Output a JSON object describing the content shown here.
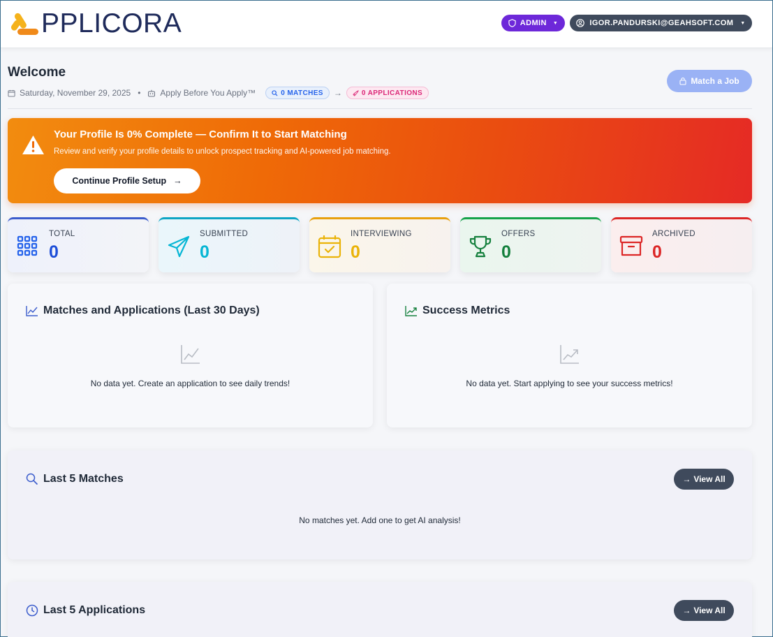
{
  "header": {
    "logo_text": "PPLICORA",
    "admin_label": "ADMIN",
    "user_label": "IGOR.PANDURSKI@GEAHSOFT.COM"
  },
  "welcome": {
    "title": "Welcome",
    "date": "Saturday, November 29, 2025",
    "separator": "•",
    "tagline": "Apply Before You Apply™",
    "matches_pill": "0 MATCHES",
    "arrow": "→",
    "applications_pill": "0 APPLICATIONS",
    "match_job_label": "Match a Job"
  },
  "banner": {
    "title": "Your Profile Is 0% Complete — Confirm It to Start Matching",
    "text": "Review and verify your profile details to unlock prospect tracking and AI-powered job matching.",
    "button_label": "Continue Profile Setup",
    "button_arrow": "→"
  },
  "stats": [
    {
      "label": "TOTAL",
      "value": "0",
      "color": "#1d4ed8"
    },
    {
      "label": "SUBMITTED",
      "value": "0",
      "color": "#06b6d4"
    },
    {
      "label": "INTERVIEWING",
      "value": "0",
      "color": "#eab308"
    },
    {
      "label": "OFFERS",
      "value": "0",
      "color": "#15803d"
    },
    {
      "label": "ARCHIVED",
      "value": "0",
      "color": "#dc2626"
    }
  ],
  "charts": {
    "trends_title": "Matches and Applications (Last 30 Days)",
    "trends_empty": "No data yet. Create an application to see daily trends!",
    "success_title": "Success Metrics",
    "success_empty": "No data yet. Start applying to see your success metrics!"
  },
  "matches": {
    "title": "Last 5 Matches",
    "view_all": "View All",
    "view_all_arrow": "→",
    "empty": "No matches yet. Add one to get AI analysis!"
  },
  "applications": {
    "title": "Last 5 Applications",
    "view_all": "View All",
    "view_all_arrow": "→"
  }
}
